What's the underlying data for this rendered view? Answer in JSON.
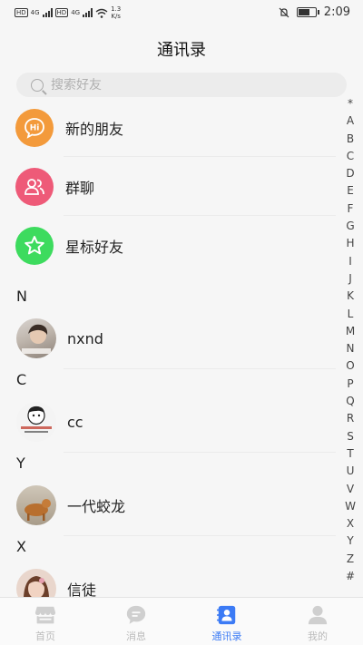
{
  "statusbar": {
    "sim1": "HD",
    "sim2": "HD",
    "net_label": "4G",
    "speed": "1.3",
    "speed_unit": "K/s",
    "time": "2:09",
    "battery_level": 0.7
  },
  "header": {
    "title": "通讯录"
  },
  "search": {
    "placeholder": "搜索好友"
  },
  "functions": [
    {
      "label": "新的朋友",
      "color": "#F39A3B",
      "icon": "hi-bubble-icon",
      "glyph": "Hi"
    },
    {
      "label": "群聊",
      "color": "#EE5A78",
      "icon": "group-icon"
    },
    {
      "label": "星标好友",
      "color": "#3DDB5E",
      "icon": "star-icon"
    }
  ],
  "contacts": [
    {
      "letter": "N",
      "name": "nxnd"
    },
    {
      "letter": "C",
      "name": "cc"
    },
    {
      "letter": "Y",
      "name": "一代蛟龙"
    },
    {
      "letter": "X",
      "name": "信徒"
    }
  ],
  "index_letters": [
    "*",
    "A",
    "B",
    "C",
    "D",
    "E",
    "F",
    "G",
    "H",
    "I",
    "J",
    "K",
    "L",
    "M",
    "N",
    "O",
    "P",
    "Q",
    "R",
    "S",
    "T",
    "U",
    "V",
    "W",
    "X",
    "Y",
    "Z",
    "#"
  ],
  "tabs": [
    {
      "label": "首页",
      "icon": "store-icon",
      "active": false
    },
    {
      "label": "消息",
      "icon": "chat-bubble-icon",
      "active": false
    },
    {
      "label": "通讯录",
      "icon": "contacts-book-icon",
      "active": true
    },
    {
      "label": "我的",
      "icon": "person-icon",
      "active": false
    }
  ],
  "colors": {
    "accent": "#3C7BF5",
    "inactive": "#BBBBBB"
  }
}
